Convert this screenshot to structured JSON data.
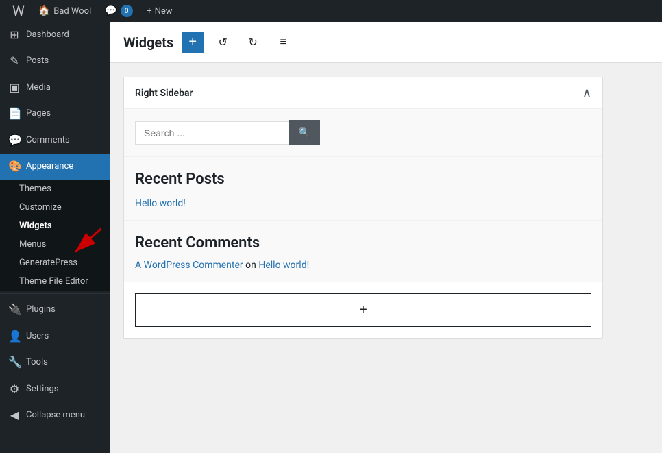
{
  "adminbar": {
    "logo": "W",
    "site": "Bad Wool",
    "comments_count": "0",
    "new_label": "New"
  },
  "sidebar": {
    "items": [
      {
        "id": "dashboard",
        "label": "Dashboard",
        "icon": "⊞"
      },
      {
        "id": "posts",
        "label": "Posts",
        "icon": "✎"
      },
      {
        "id": "media",
        "label": "Media",
        "icon": "▣"
      },
      {
        "id": "pages",
        "label": "Pages",
        "icon": "📄"
      },
      {
        "id": "comments",
        "label": "Comments",
        "icon": "💬"
      },
      {
        "id": "appearance",
        "label": "Appearance",
        "icon": "🎨"
      }
    ],
    "appearance_subitems": [
      {
        "id": "themes",
        "label": "Themes",
        "bold": false
      },
      {
        "id": "customize",
        "label": "Customize",
        "bold": false
      },
      {
        "id": "widgets",
        "label": "Widgets",
        "bold": true
      },
      {
        "id": "menus",
        "label": "Menus",
        "bold": false
      },
      {
        "id": "generatepress",
        "label": "GeneratePress",
        "bold": false
      },
      {
        "id": "theme-file-editor",
        "label": "Theme File Editor",
        "bold": false
      }
    ],
    "bottom_items": [
      {
        "id": "plugins",
        "label": "Plugins",
        "icon": "🔌"
      },
      {
        "id": "users",
        "label": "Users",
        "icon": "👤"
      },
      {
        "id": "tools",
        "label": "Tools",
        "icon": "🔧"
      },
      {
        "id": "settings",
        "label": "Settings",
        "icon": "⚙"
      },
      {
        "id": "collapse",
        "label": "Collapse menu",
        "icon": "◀"
      }
    ]
  },
  "header": {
    "title": "Widgets",
    "add_block_label": "+",
    "undo_icon": "↺",
    "redo_icon": "↻",
    "more_icon": "≡"
  },
  "widget_panel": {
    "title": "Right Sidebar",
    "collapse_icon": "∧",
    "search": {
      "placeholder": "Search ...",
      "button_label": "Search"
    },
    "recent_posts": {
      "title": "Recent Posts",
      "posts": [
        {
          "label": "Hello world!",
          "url": "#"
        }
      ]
    },
    "recent_comments": {
      "title": "Recent Comments",
      "comment_author": "A WordPress Commenter",
      "on_text": "on",
      "post_link": "Hello world!"
    },
    "add_block_btn": "+"
  }
}
